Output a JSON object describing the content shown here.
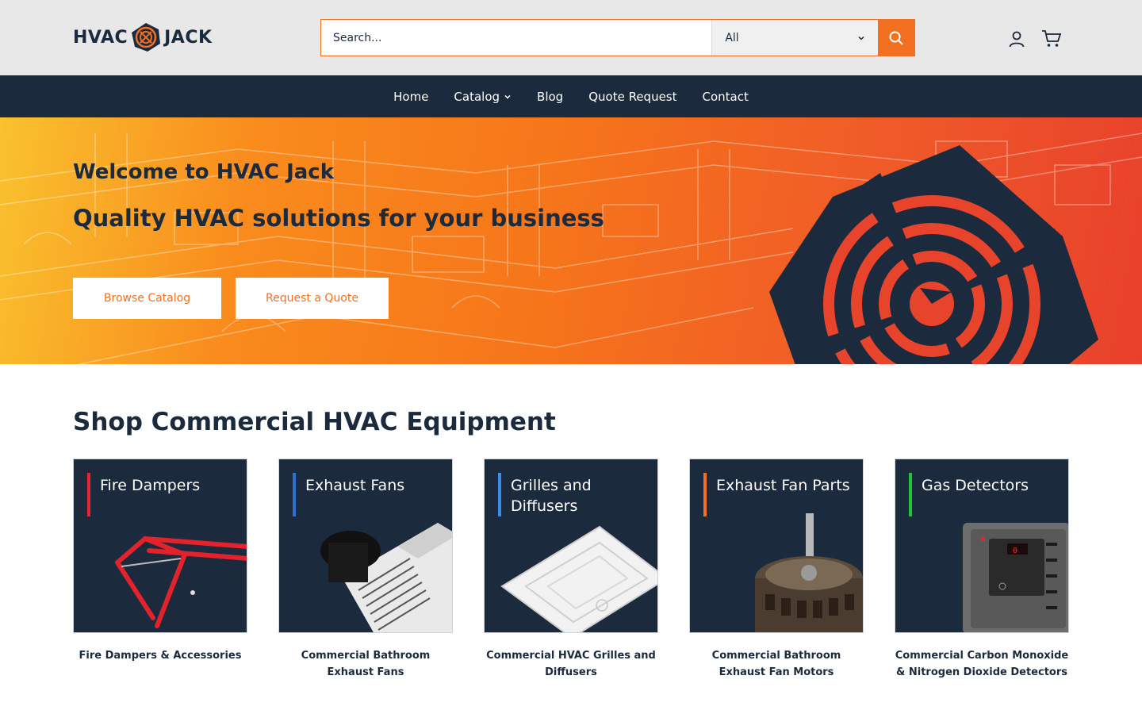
{
  "header": {
    "logo_left": "HVAC",
    "logo_right": "JACK",
    "search": {
      "placeholder": "Search...",
      "category": "All"
    }
  },
  "nav": {
    "items": [
      "Home",
      "Catalog",
      "Blog",
      "Quote Request",
      "Contact"
    ]
  },
  "hero": {
    "title": "Welcome to HVAC Jack",
    "subtitle": "Quality HVAC solutions for your business",
    "browse_label": "Browse Catalog",
    "quote_label": "Request a Quote"
  },
  "section": {
    "title": "Shop Commercial HVAC Equipment",
    "cards": [
      {
        "heading": "Fire Dampers",
        "caption": "Fire Dampers & Accessories",
        "accent": "#e8242e"
      },
      {
        "heading": "Exhaust Fans",
        "caption": "Commercial Bathroom Exhaust Fans",
        "accent": "#2f6fd0"
      },
      {
        "heading": "Grilles and Diffusers",
        "caption": "Commercial HVAC Grilles and Diffusers",
        "accent": "#3a8ee6"
      },
      {
        "heading": "Exhaust Fan Parts",
        "caption": "Commercial Bathroom Exhaust Fan Motors",
        "accent": "#f37021"
      },
      {
        "heading": "Gas Detectors",
        "caption": "Commercial Carbon Monoxide & Nitrogen Dioxide Detectors",
        "accent": "#22c23a"
      }
    ]
  },
  "colors": {
    "brand_navy": "#1b2a3d",
    "brand_orange": "#f37021"
  }
}
